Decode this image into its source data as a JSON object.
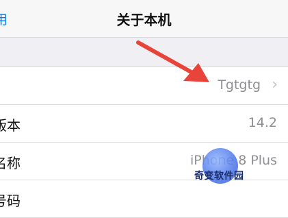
{
  "navbar": {
    "back_label": "用",
    "title": "关于本机"
  },
  "rows": [
    {
      "label": "",
      "value": "Tgtgtg",
      "chevron": "›"
    },
    {
      "label": "版本",
      "value": "14.2"
    },
    {
      "label": "名称",
      "value": "iPhone 8 Plus"
    },
    {
      "label": "号码",
      "value": ""
    }
  ],
  "watermark": {
    "text": "奇变软件园"
  },
  "colors": {
    "arrow": "#e8443a",
    "link": "#007aff"
  }
}
